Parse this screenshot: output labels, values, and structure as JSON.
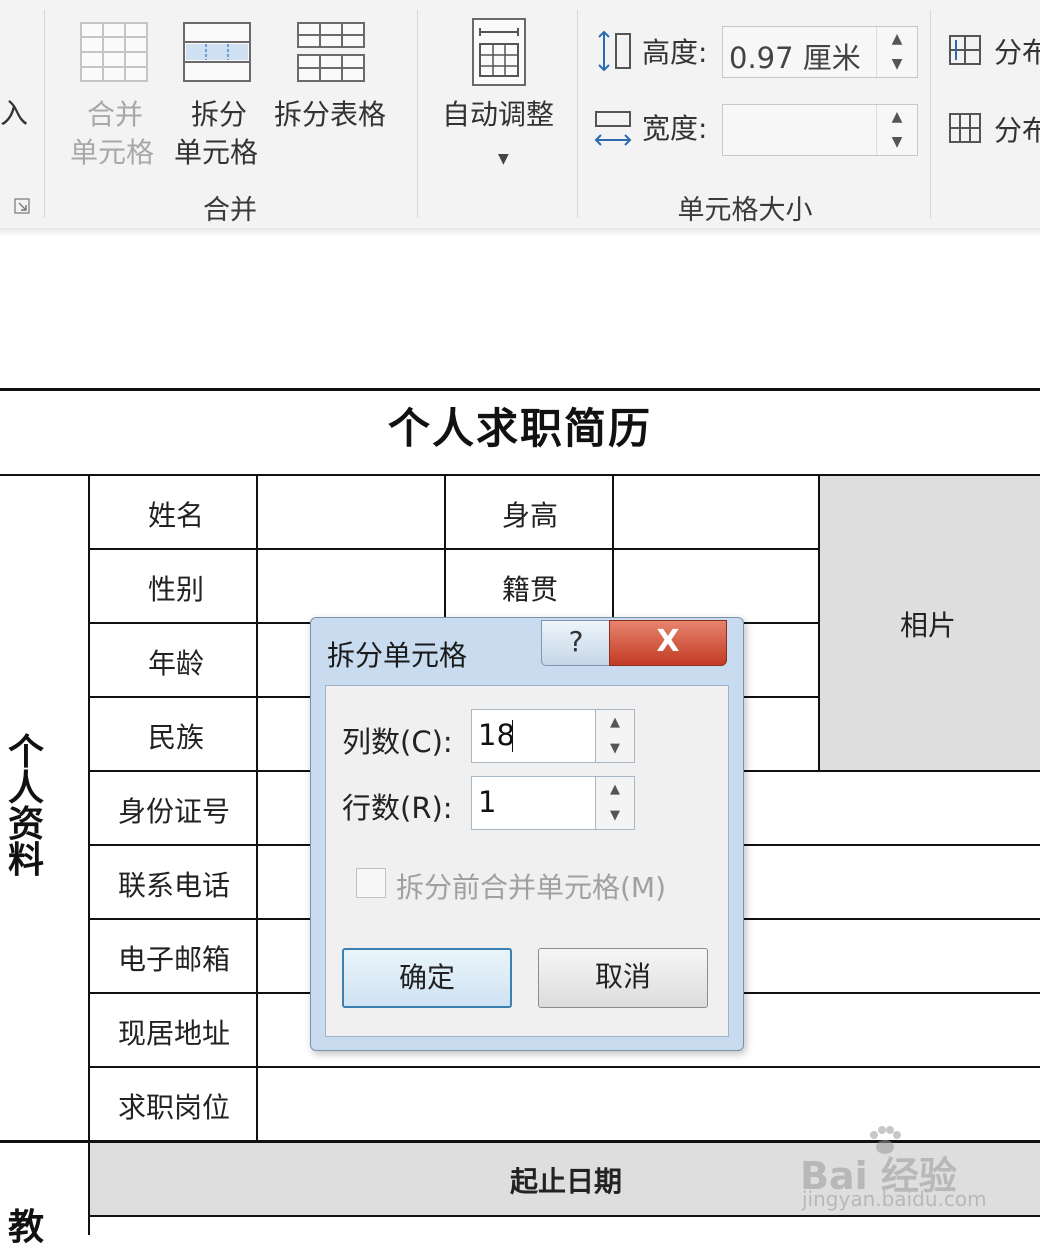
{
  "ribbon": {
    "partial_left_label": "入",
    "merge_cells": {
      "line1": "合并",
      "line2": "单元格"
    },
    "split_cells": {
      "line1": "拆分",
      "line2": "单元格"
    },
    "split_table": "拆分表格",
    "merge_group_label": "合并",
    "autofit": "自动调整",
    "height_label": "高度:",
    "height_value": "0.97 厘米",
    "width_label": "宽度:",
    "width_value": "",
    "distribute_rows": "分布",
    "distribute_cols": "分布",
    "cell_size_group_label": "单元格大小"
  },
  "document": {
    "title": "个人求职简历",
    "section_label": "个人资料",
    "next_section_label": "教",
    "rows": [
      "姓名",
      "性别",
      "年龄",
      "民族",
      "身份证号",
      "联系电话",
      "电子邮箱",
      "现居地址",
      "求职岗位"
    ],
    "height_label": "身高",
    "native_place_label": "籍贯",
    "photo_label": "相片",
    "period_header": "起止日期"
  },
  "dialog": {
    "title": "拆分单元格",
    "help": "?",
    "close": "X",
    "columns_label": "列数(C):",
    "columns_value": "18",
    "rows_label": "行数(R):",
    "rows_value": "1",
    "merge_before_split": "拆分前合并单元格(M)",
    "merge_before_split_checked": false,
    "ok": "确定",
    "cancel": "取消"
  },
  "watermark": {
    "brand": "Bai 经验",
    "url": "jingyan.baidu.com"
  }
}
